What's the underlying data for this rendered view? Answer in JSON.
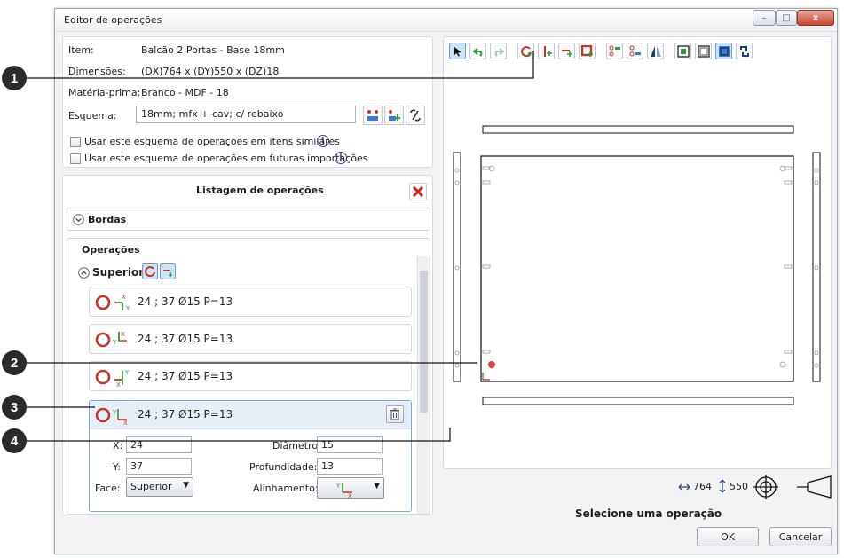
{
  "window": {
    "title": "Editor de operações",
    "min": "–",
    "max": "□",
    "close": "x"
  },
  "info": {
    "item_label": "Item:",
    "item_value": "Balcão 2 Portas - Base 18mm",
    "dim_label": "Dimensões:",
    "dim_value": "(DX)764 x (DY)550 x (DZ)18",
    "mat_label": "Matéria-prima:",
    "mat_value": "Branco - MDF - 18",
    "schema_label": "Esquema:",
    "schema_value": "18mm; mfx + cav; c/ rebaixo",
    "check1": "Usar este esquema de operações em itens similares",
    "check2": "Usar este esquema de operações em futuras importações",
    "info_glyph": "i"
  },
  "list": {
    "title": "Listagem de operações",
    "bordas": "Bordas",
    "operacoes": "Operações",
    "face_group": "Superior",
    "ops": [
      {
        "text": "24 ; 37 Ø15 P=13"
      },
      {
        "text": "24 ; 37 Ø15 P=13"
      },
      {
        "text": "24 ; 37 Ø15 P=13"
      },
      {
        "text": "24 ; 37 Ø15 P=13"
      }
    ],
    "axis_x": "X",
    "axis_y": "Y"
  },
  "detail": {
    "x_label": "X:",
    "x_value": "24",
    "y_label": "Y:",
    "y_value": "37",
    "face_label": "Face:",
    "face_value": "Superior",
    "diam_label": "Diâmetro:",
    "diam_value": "15",
    "prof_label": "Profundidade:",
    "prof_value": "13",
    "align_label": "Alinhamento:"
  },
  "preview": {
    "width_value": "764",
    "height_value": "550",
    "status": "Selecione uma operação"
  },
  "callouts": [
    "1",
    "2",
    "3",
    "4"
  ],
  "buttons": {
    "ok": "OK",
    "cancel": "Cancelar"
  },
  "colors": {
    "accent": "#c0392b",
    "green": "#2e9e3e",
    "blue": "#3a7bd5"
  }
}
